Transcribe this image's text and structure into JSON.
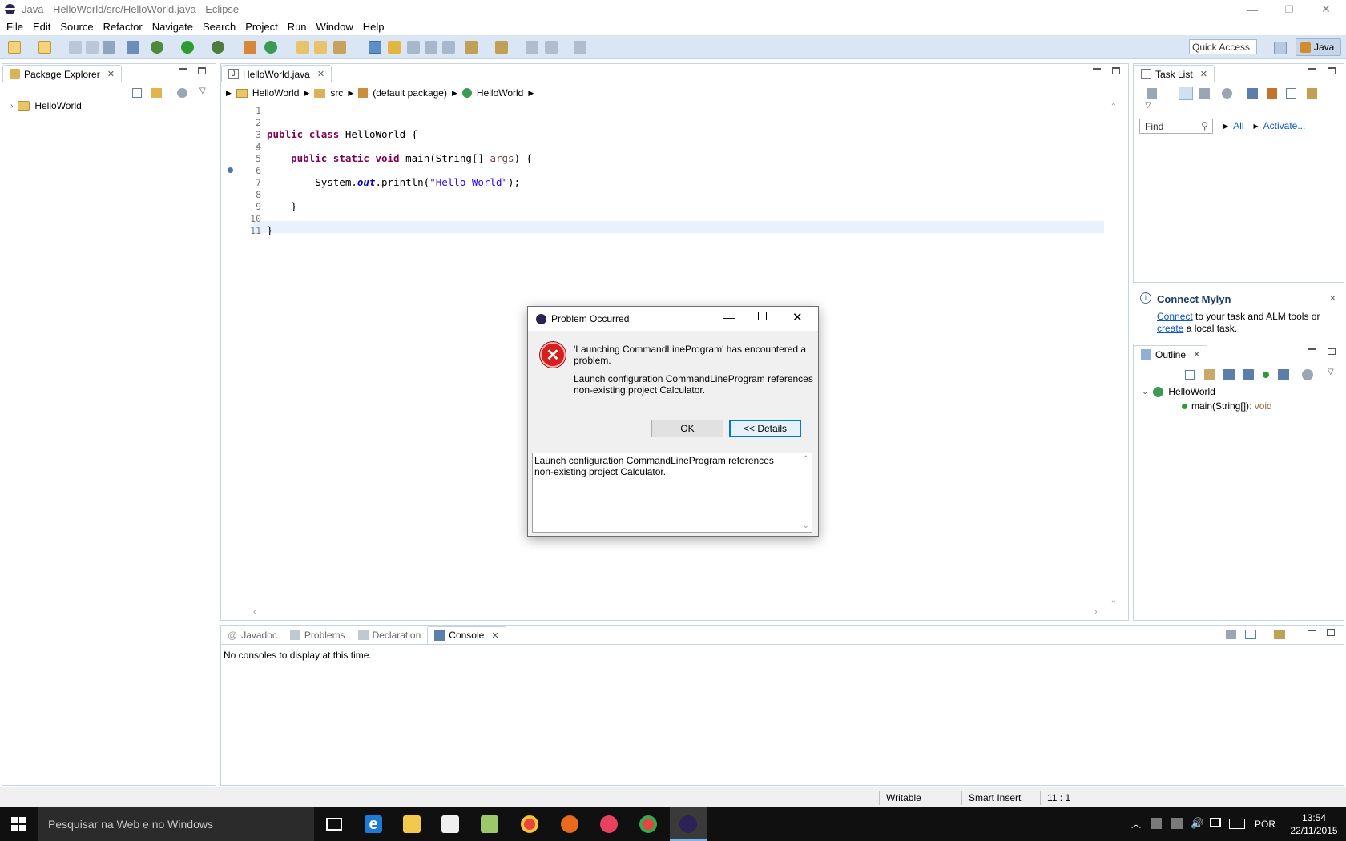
{
  "window": {
    "title": "Java - HelloWorld/src/HelloWorld.java - Eclipse"
  },
  "menu": [
    "File",
    "Edit",
    "Source",
    "Refactor",
    "Navigate",
    "Search",
    "Project",
    "Run",
    "Window",
    "Help"
  ],
  "toolbar": {
    "quick_access": "Quick Access",
    "perspective": "Java"
  },
  "package_explorer": {
    "tab": "Package Explorer",
    "project": "HelloWorld"
  },
  "editor": {
    "tab": "HelloWorld.java",
    "breadcrumb": [
      "HelloWorld",
      "src",
      "(default package)",
      "HelloWorld"
    ],
    "line_numbers": [
      "1",
      "2",
      "3",
      "4",
      "5",
      "6",
      "7",
      "8",
      "9",
      "10",
      "11"
    ]
  },
  "task_list": {
    "tab": "Task List",
    "find_placeholder": "Find",
    "all": "All",
    "activate": "Activate..."
  },
  "mylyn": {
    "title": "Connect Mylyn",
    "connect": "Connect",
    "text1": " to your task and ALM tools or",
    "create": "create",
    "text2": " a local task."
  },
  "outline": {
    "tab": "Outline",
    "class": "HelloWorld",
    "method": "main(String[])",
    "return": " : void"
  },
  "bottom": {
    "tabs": [
      "Javadoc",
      "Problems",
      "Declaration",
      "Console"
    ],
    "message": "No consoles to display at this time."
  },
  "dialog": {
    "title": "Problem Occurred",
    "msg1a": "'Launching CommandLineProgram' has encountered a",
    "msg1b": "problem.",
    "msg2a": "Launch configuration CommandLineProgram references",
    "msg2b": "non-existing project Calculator.",
    "ok": "OK",
    "details": "<< Details",
    "details_a": "Launch configuration CommandLineProgram references",
    "details_b": "non-existing project Calculator."
  },
  "status": {
    "writable": "Writable",
    "insert": "Smart Insert",
    "position": "11 : 1"
  },
  "taskbar": {
    "search": "Pesquisar na Web e no Windows",
    "lang": "POR",
    "time": "13:54",
    "date": "22/11/2015"
  }
}
